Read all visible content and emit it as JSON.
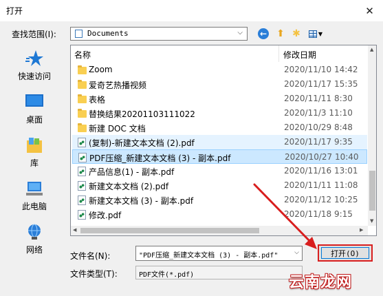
{
  "window": {
    "title": "打开",
    "close_glyph": "✕"
  },
  "lookin": {
    "label": "查找范围(I):",
    "value": "Documents"
  },
  "toolbar": {
    "back": "back-icon",
    "up": "up-folder-icon",
    "new_folder": "new-folder-icon",
    "view": "view-menu-icon"
  },
  "places": [
    {
      "label": "快速访问",
      "icon": "star-icon"
    },
    {
      "label": "桌面",
      "icon": "desktop-icon"
    },
    {
      "label": "库",
      "icon": "library-icon"
    },
    {
      "label": "此电脑",
      "icon": "computer-icon"
    },
    {
      "label": "网络",
      "icon": "network-icon"
    }
  ],
  "columns": {
    "name": "名称",
    "date": "修改日期"
  },
  "files": [
    {
      "name": "Zoom",
      "date": "2020/11/10 14:42",
      "type": "folder"
    },
    {
      "name": "爱奇艺热播视频",
      "date": "2020/11/17 15:35",
      "type": "folder"
    },
    {
      "name": "表格",
      "date": "2020/11/11 8:30",
      "type": "folder"
    },
    {
      "name": "替换结果20201103111022",
      "date": "2020/11/3 11:10",
      "type": "folder"
    },
    {
      "name": "新建 DOC 文档",
      "date": "2020/10/29 8:48",
      "type": "folder"
    },
    {
      "name": "(复制)-新建文本文档 (2).pdf",
      "date": "2020/11/17 9:35",
      "type": "pdf"
    },
    {
      "name": "PDF压缩_新建文本文档 (3) - 副本.pdf",
      "date": "2020/10/27 10:40",
      "type": "pdf"
    },
    {
      "name": "产品信息(1) - 副本.pdf",
      "date": "2020/11/16 13:01",
      "type": "pdf"
    },
    {
      "name": "新建文本文档 (2).pdf",
      "date": "2020/11/11 11:08",
      "type": "pdf"
    },
    {
      "name": "新建文本文档 (3) - 副本.pdf",
      "date": "2020/11/12 10:25",
      "type": "pdf"
    },
    {
      "name": "修改.pdf",
      "date": "2020/11/18 9:15",
      "type": "pdf"
    }
  ],
  "selected_index": 6,
  "hover_index": 5,
  "filename": {
    "label": "文件名(N):",
    "value": "\"PDF压缩_新建文本文档 (3) - 副本.pdf\""
  },
  "filetype": {
    "label": "文件类型(T):",
    "value": "PDF文件(*.pdf)"
  },
  "open_button": {
    "label": "打开(O)"
  },
  "watermark": "云南龙网",
  "colors": {
    "selection": "#cce8ff",
    "highlight": "#d81e1e",
    "accent": "#0078d7"
  }
}
